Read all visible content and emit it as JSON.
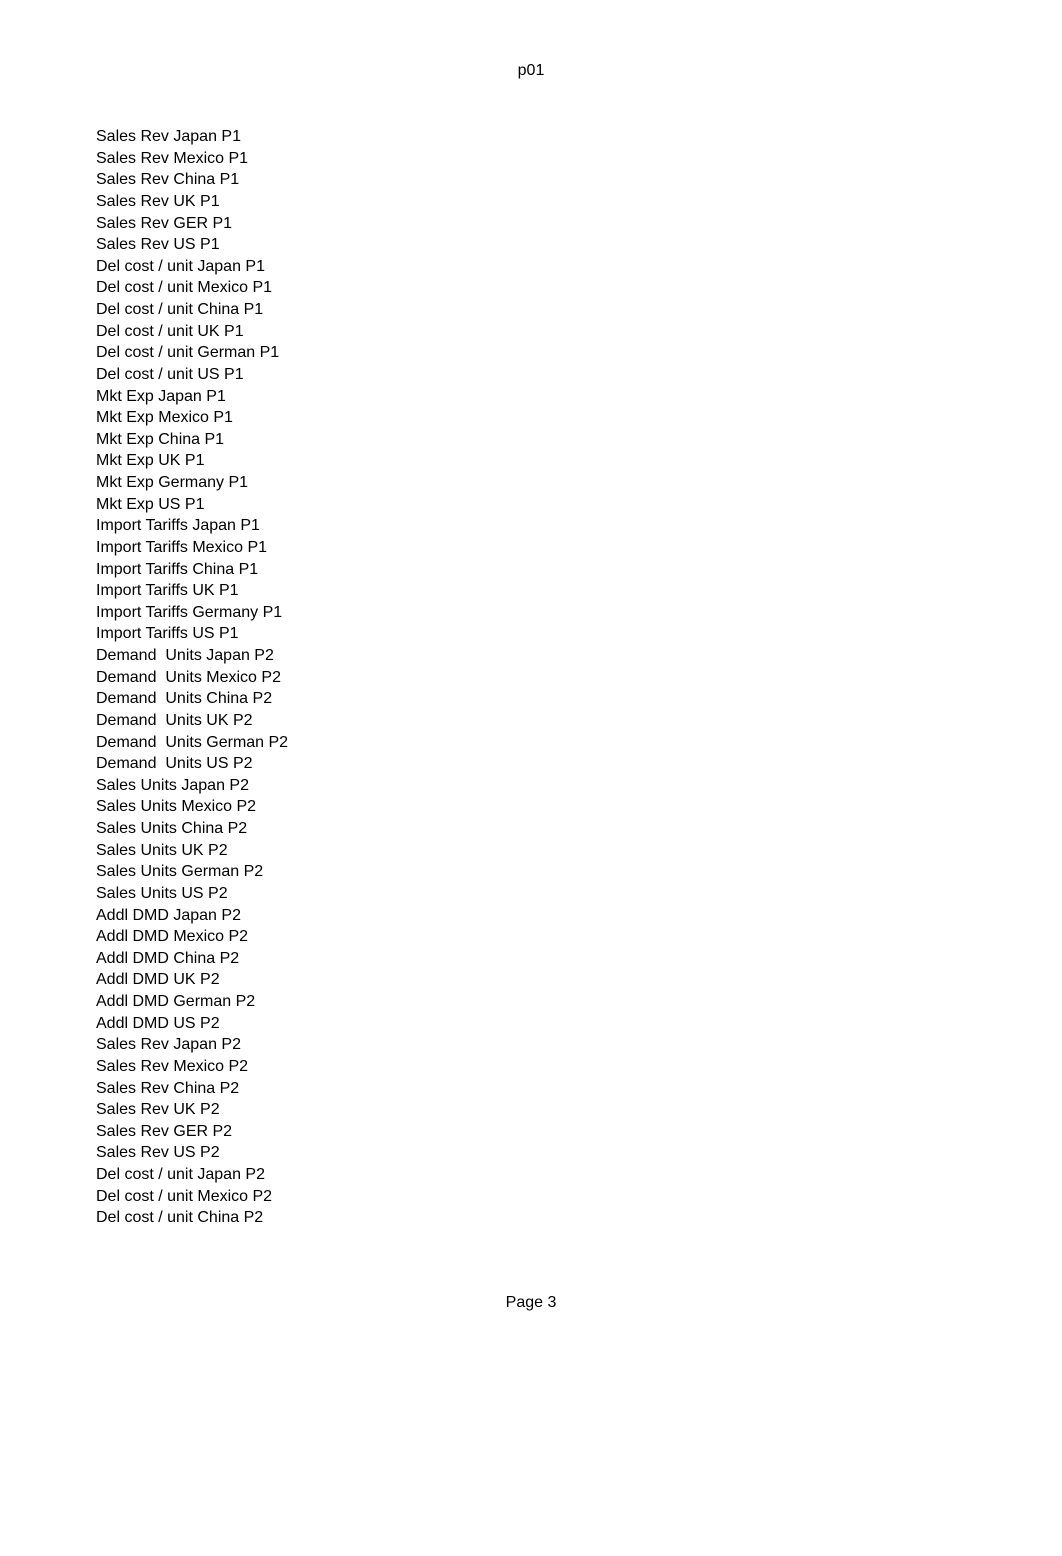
{
  "document": {
    "header": "p01",
    "footer": "Page 3",
    "background_color": "#ffffff",
    "text_color": "#000000"
  },
  "items": [
    {
      "label": "Sales Rev Japan P1"
    },
    {
      "label": "Sales Rev Mexico P1"
    },
    {
      "label": "Sales Rev China P1"
    },
    {
      "label": "Sales Rev UK P1"
    },
    {
      "label": "Sales Rev GER P1"
    },
    {
      "label": "Sales Rev US P1"
    },
    {
      "label": "Del cost / unit Japan P1"
    },
    {
      "label": "Del cost / unit Mexico P1"
    },
    {
      "label": "Del cost / unit China P1"
    },
    {
      "label": "Del cost / unit UK P1"
    },
    {
      "label": "Del cost / unit German P1"
    },
    {
      "label": "Del cost / unit US P1"
    },
    {
      "label": "Mkt Exp Japan P1"
    },
    {
      "label": "Mkt Exp Mexico P1"
    },
    {
      "label": "Mkt Exp China P1"
    },
    {
      "label": "Mkt Exp UK P1"
    },
    {
      "label": "Mkt Exp Germany P1"
    },
    {
      "label": "Mkt Exp US P1"
    },
    {
      "label": "Import Tariffs Japan P1"
    },
    {
      "label": "Import Tariffs Mexico P1"
    },
    {
      "label": "Import Tariffs China P1"
    },
    {
      "label": "Import Tariffs UK P1"
    },
    {
      "label": "Import Tariffs Germany P1"
    },
    {
      "label": "Import Tariffs US P1"
    },
    {
      "label": "Demand  Units Japan P2"
    },
    {
      "label": "Demand  Units Mexico P2"
    },
    {
      "label": "Demand  Units China P2"
    },
    {
      "label": "Demand  Units UK P2"
    },
    {
      "label": "Demand  Units German P2"
    },
    {
      "label": "Demand  Units US P2"
    },
    {
      "label": "Sales Units Japan P2"
    },
    {
      "label": "Sales Units Mexico P2"
    },
    {
      "label": "Sales Units China P2"
    },
    {
      "label": "Sales Units UK P2"
    },
    {
      "label": "Sales Units German P2"
    },
    {
      "label": "Sales Units US P2"
    },
    {
      "label": "Addl DMD Japan P2"
    },
    {
      "label": "Addl DMD Mexico P2"
    },
    {
      "label": "Addl DMD China P2"
    },
    {
      "label": "Addl DMD UK P2"
    },
    {
      "label": "Addl DMD German P2"
    },
    {
      "label": "Addl DMD US P2"
    },
    {
      "label": "Sales Rev Japan P2"
    },
    {
      "label": "Sales Rev Mexico P2"
    },
    {
      "label": "Sales Rev China P2"
    },
    {
      "label": "Sales Rev UK P2"
    },
    {
      "label": "Sales Rev GER P2"
    },
    {
      "label": "Sales Rev US P2"
    },
    {
      "label": "Del cost / unit Japan P2"
    },
    {
      "label": "Del cost / unit Mexico P2"
    },
    {
      "label": "Del cost / unit China P2"
    }
  ]
}
